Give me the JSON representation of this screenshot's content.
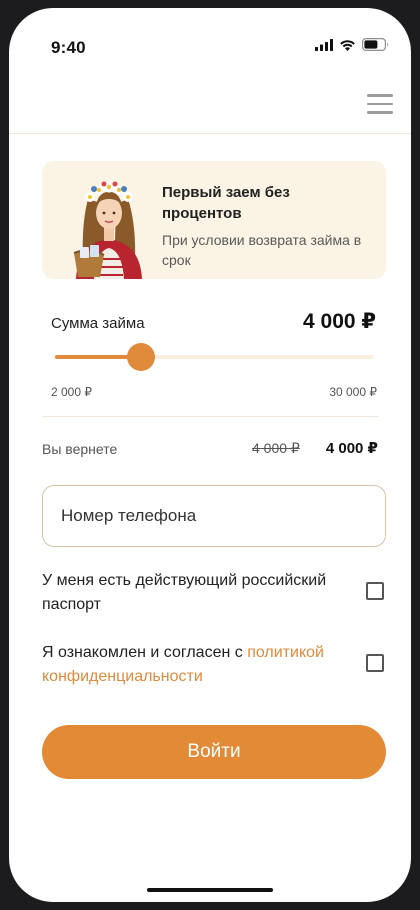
{
  "status_bar": {
    "time": "9:40",
    "icons": [
      "cellular-signal-icon",
      "wifi-icon",
      "battery-icon"
    ]
  },
  "header": {
    "menu_icon": "hamburger-menu-icon"
  },
  "banner": {
    "title": "Первый заем без процентов",
    "subtitle": "При условии возврата займа в срок",
    "illustration": "woman-in-flower-wreath-illustration"
  },
  "loan": {
    "label": "Сумма займа",
    "value": "4 000 ₽",
    "min_label": "2 000 ₽",
    "max_label": "30 000 ₽",
    "slider_level": 0.27
  },
  "repayment": {
    "label": "Вы вернете",
    "old_amount": "4 000 ₽",
    "new_amount": "4 000 ₽"
  },
  "phone_field": {
    "placeholder": "Номер телефона",
    "value": ""
  },
  "agreements": {
    "passport_text": "У меня есть действующий российский паспорт",
    "passport_checked": false,
    "policy_text": "Я ознакомлен и согласен с ",
    "policy_link": "политикой конфиденциальности",
    "policy_checked": false
  },
  "login_button": {
    "label": "Войти"
  },
  "colors": {
    "accent": "#e38a37",
    "banner_bg": "#fbf3e4",
    "slider_track": "#fbeee0",
    "input_border": "#d9c4a6"
  }
}
